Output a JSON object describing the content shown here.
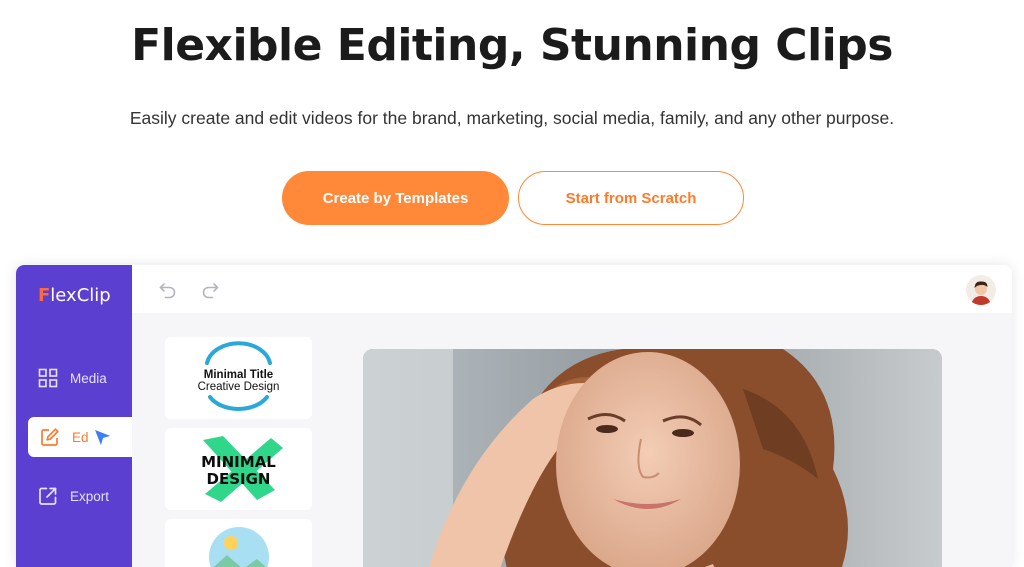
{
  "hero": {
    "title": "Flexible Editing, Stunning Clips",
    "subtitle": "Easily create and edit videos for the brand, marketing, social media, family, and any other purpose."
  },
  "buttons": {
    "primary": "Create by Templates",
    "secondary": "Start from Scratch"
  },
  "app": {
    "logo_first": "F",
    "logo_rest": "lexClip",
    "sidebar": [
      {
        "label": "Media",
        "icon": "grid-icon"
      },
      {
        "label": "Ed",
        "icon": "edit-icon"
      },
      {
        "label": "Export",
        "icon": "export-icon"
      }
    ],
    "templates": {
      "card1_line1": "Minimal Title",
      "card1_line2": "Creative Design",
      "card2_line1": "MINIMAL",
      "card2_line2": "DESIGN"
    }
  },
  "colors": {
    "accent": "#ff8839",
    "sidebar": "#5a3fd1",
    "title_ring": "#2aa8d8",
    "brush": "#30d68a"
  }
}
